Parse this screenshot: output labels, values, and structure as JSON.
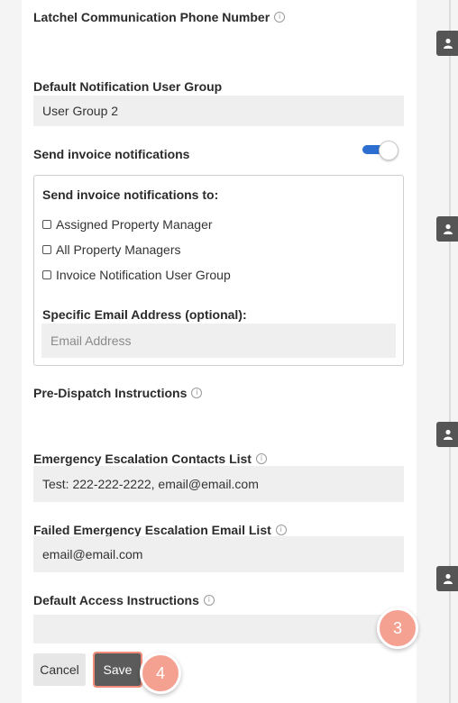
{
  "fields": {
    "phone_label": "Latchel Communication Phone Number",
    "user_group_label": "Default Notification User Group",
    "user_group_value": "User Group 2",
    "send_invoice_label": "Send invoice notifications",
    "send_invoice_enabled": true,
    "pre_dispatch_label": "Pre-Dispatch Instructions",
    "escalation_label": "Emergency Escalation Contacts List",
    "escalation_value": "Test: 222-222-2222, email@email.com",
    "failed_escalation_label": "Failed Emergency Escalation Email List",
    "failed_escalation_value": "email@email.com",
    "access_label": "Default Access Instructions",
    "access_value": ""
  },
  "invoice_box": {
    "title": "Send invoice notifications to:",
    "options": [
      {
        "label": "Assigned Property Manager",
        "checked": false
      },
      {
        "label": "All Property Managers",
        "checked": false
      },
      {
        "label": "Invoice Notification User Group",
        "checked": false
      }
    ],
    "email_label": "Specific Email Address (optional):",
    "email_placeholder": "Email Address"
  },
  "buttons": {
    "cancel": "Cancel",
    "save": "Save"
  },
  "steps": {
    "three": "3",
    "four": "4"
  },
  "icons": {
    "info": "info-icon",
    "user": "user-icon"
  },
  "colors": {
    "toggle_on": "#2d6fd0",
    "highlight": "#f4a192"
  }
}
